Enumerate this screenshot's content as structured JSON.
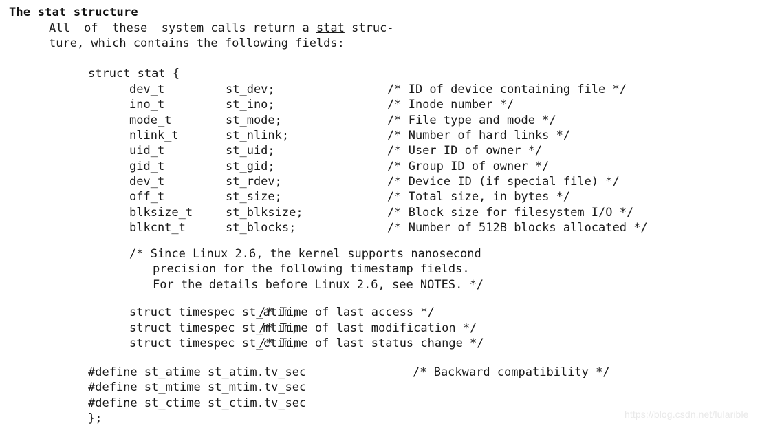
{
  "heading": "The stat structure",
  "intro": {
    "line1_before": "All  of  these  system calls return a ",
    "line1_link": "stat",
    "line1_after": " struc-",
    "line2": "ture, which contains the following fields:"
  },
  "code": {
    "struct_open": "struct stat {",
    "fields": [
      {
        "type": "dev_t",
        "name": "st_dev;",
        "comment": "/* ID of device containing file */"
      },
      {
        "type": "ino_t",
        "name": "st_ino;",
        "comment": "/* Inode number */"
      },
      {
        "type": "mode_t",
        "name": "st_mode;",
        "comment": "/* File type and mode */"
      },
      {
        "type": "nlink_t",
        "name": "st_nlink;",
        "comment": "/* Number of hard links */"
      },
      {
        "type": "uid_t",
        "name": "st_uid;",
        "comment": "/* User ID of owner */"
      },
      {
        "type": "gid_t",
        "name": "st_gid;",
        "comment": "/* Group ID of owner */"
      },
      {
        "type": "dev_t",
        "name": "st_rdev;",
        "comment": "/* Device ID (if special file) */"
      },
      {
        "type": "off_t",
        "name": "st_size;",
        "comment": "/* Total size, in bytes */"
      },
      {
        "type": "blksize_t",
        "name": "st_blksize;",
        "comment": "/* Block size for filesystem I/O */"
      },
      {
        "type": "blkcnt_t",
        "name": "st_blocks;",
        "comment": "/* Number of 512B blocks allocated */"
      }
    ],
    "note_comment": [
      "/* Since Linux 2.6, the kernel supports nanosecond",
      "precision for the following timestamp fields.",
      "For the details before Linux 2.6, see NOTES. */"
    ],
    "timespecs": [
      {
        "decl": "struct timespec st_atim;",
        "comment": "/* Time of last access */"
      },
      {
        "decl": "struct timespec st_mtim;",
        "comment": "/* Time of last modification */"
      },
      {
        "decl": "struct timespec st_ctim;",
        "comment": "/* Time of last status change */"
      }
    ],
    "defines": [
      {
        "text": "#define st_atime st_atim.tv_sec",
        "comment": "/* Backward compatibility */"
      },
      {
        "text": "#define st_mtime st_mtim.tv_sec",
        "comment": ""
      },
      {
        "text": "#define st_ctime st_ctim.tv_sec",
        "comment": ""
      }
    ],
    "struct_close": "};"
  },
  "watermark": "https://blog.csdn.net/lularible"
}
